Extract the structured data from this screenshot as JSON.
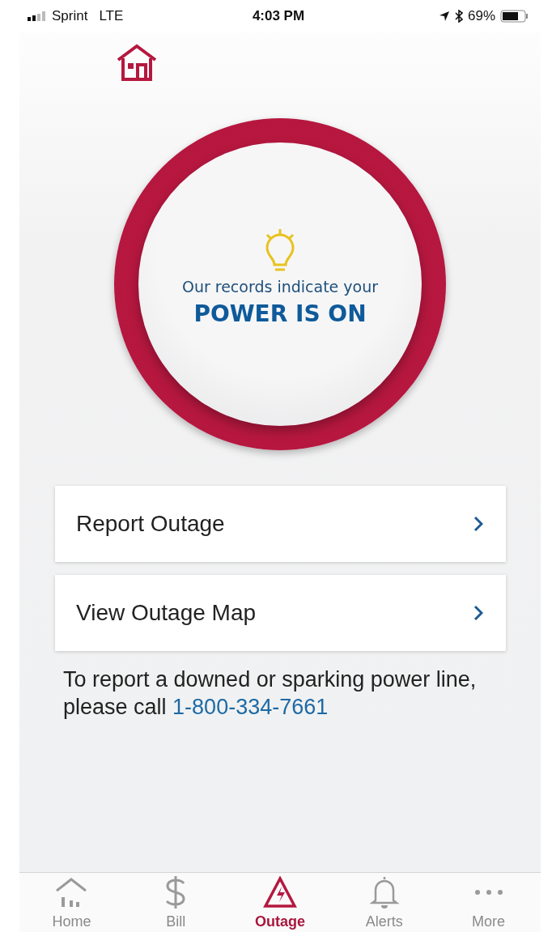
{
  "status_bar": {
    "carrier": "Sprint",
    "network": "LTE",
    "time": "4:03 PM",
    "battery": "69%"
  },
  "outage_status": {
    "caption": "Our records indicate your",
    "status": "POWER IS ON",
    "on": true
  },
  "actions": [
    {
      "label": "Report Outage"
    },
    {
      "label": "View Outage Map"
    }
  ],
  "notice": {
    "text": "To report a downed or sparking power line, please call",
    "phone": "1-800-334-7661"
  },
  "tabs": [
    {
      "kind": "home",
      "label": "Home",
      "selected": false
    },
    {
      "kind": "bill",
      "label": "Bill",
      "selected": false
    },
    {
      "kind": "outage",
      "label": "Outage",
      "selected": true
    },
    {
      "kind": "alerts",
      "label": "Alerts",
      "selected": false
    },
    {
      "kind": "more",
      "label": "More",
      "selected": false
    }
  ]
}
